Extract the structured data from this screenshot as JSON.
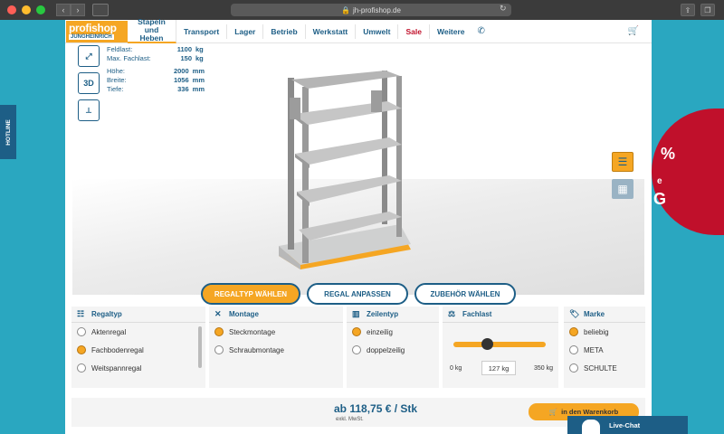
{
  "browser": {
    "url": "jh-profishop.de"
  },
  "nav": {
    "logo_main": "profishop",
    "logo_sub": "JUNGHEINRICH",
    "items": [
      {
        "label": "Stapeln und Heben"
      },
      {
        "label": "Transport"
      },
      {
        "label": "Lager"
      },
      {
        "label": "Betrieb"
      },
      {
        "label": "Werkstatt"
      },
      {
        "label": "Umwelt"
      },
      {
        "label": "Sale"
      },
      {
        "label": "Weitere"
      }
    ]
  },
  "specs": {
    "rows": [
      {
        "k": "Feldlast:",
        "v": "1100",
        "u": "kg"
      },
      {
        "k": "Max. Fachlast:",
        "v": "150",
        "u": "kg"
      },
      {
        "k": "Höhe:",
        "v": "2000",
        "u": "mm"
      },
      {
        "k": "Breite:",
        "v": "1056",
        "u": "mm"
      },
      {
        "k": "Tiefe:",
        "v": "336",
        "u": "mm"
      }
    ],
    "icon_3d": "3D"
  },
  "steps": [
    {
      "label": "REGALTYP WÄHLEN"
    },
    {
      "label": "REGAL ANPASSEN"
    },
    {
      "label": "ZUBEHÖR WÄHLEN"
    }
  ],
  "filters": {
    "regaltyp": {
      "title": "Regaltyp",
      "options": [
        "Aktenregal",
        "Fachbodenregal",
        "Weitspannregal"
      ]
    },
    "montage": {
      "title": "Montage",
      "options": [
        "Steckmontage",
        "Schraubmontage"
      ]
    },
    "zeilentyp": {
      "title": "Zeilentyp",
      "options": [
        "einzeilig",
        "doppelzeilig"
      ]
    },
    "fachlast": {
      "title": "Fachlast",
      "min": "0 kg",
      "max": "350 kg",
      "value": "127",
      "unit": "kg",
      "level_fraction": 0.363
    },
    "marke": {
      "title": "Marke",
      "options": [
        "beliebig",
        "META",
        "SCHULTE"
      ]
    }
  },
  "price": {
    "text": "ab 118,75 € / Stk",
    "vat": "exkl. MwSt.",
    "cart_label": "in den Warenkorb"
  },
  "livechat": "Live-Chat",
  "hotline": "HOTLINE",
  "promo_glyphs": "%",
  "promo_lines": [
    "e",
    "G"
  ],
  "colors": {
    "accent": "#f5a623",
    "brand": "#1d5e86",
    "sale": "#c0102b",
    "bg": "#2aa7c0"
  }
}
